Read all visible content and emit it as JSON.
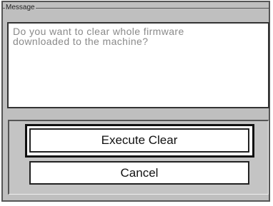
{
  "message": {
    "legend": "Message",
    "lines": [
      "Do you want to clear whole firmware",
      "downloaded to the machine?"
    ]
  },
  "buttons": {
    "execute_label": "Execute Clear",
    "cancel_label": "Cancel"
  }
}
